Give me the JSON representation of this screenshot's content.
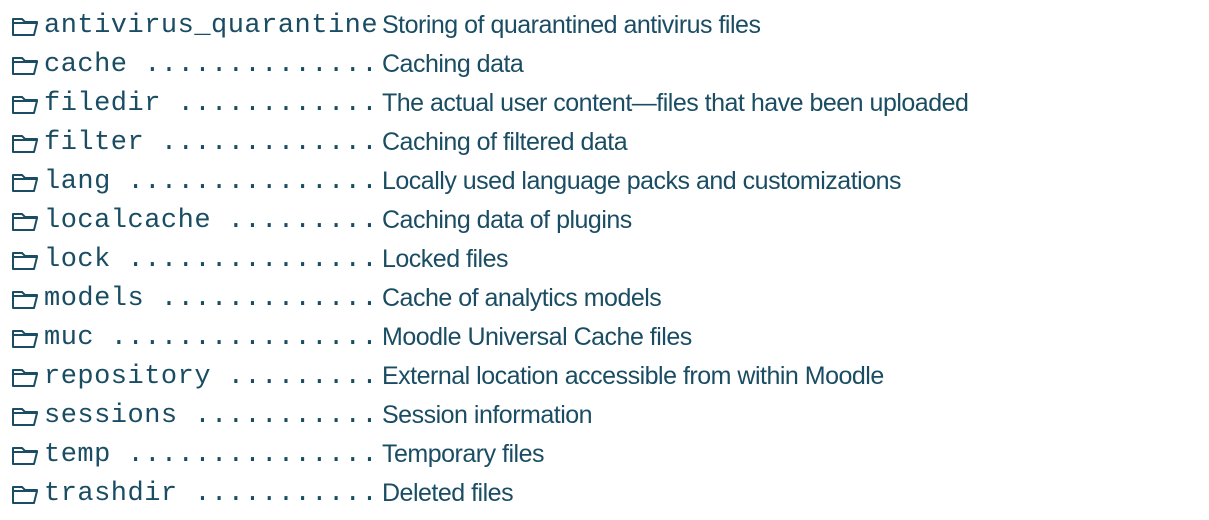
{
  "name_col_chars": 21,
  "dot_char": ".",
  "directories": [
    {
      "name": "antivirus_quarantine",
      "description": "Storing of quarantined antivirus files"
    },
    {
      "name": "cache",
      "description": "Caching data"
    },
    {
      "name": "filedir",
      "description": "The actual user content—files that have been uploaded"
    },
    {
      "name": "filter",
      "description": "Caching of filtered data"
    },
    {
      "name": "lang",
      "description": "Locally used language packs and customizations"
    },
    {
      "name": "localcache",
      "description": "Caching data of plugins"
    },
    {
      "name": "lock",
      "description": "Locked files"
    },
    {
      "name": "models",
      "description": "Cache of analytics models"
    },
    {
      "name": "muc",
      "description": "Moodle Universal Cache files"
    },
    {
      "name": "repository",
      "description": "External location accessible from within Moodle"
    },
    {
      "name": "sessions",
      "description": "Session information"
    },
    {
      "name": "temp",
      "description": "Temporary files"
    },
    {
      "name": "trashdir",
      "description": "Deleted files"
    }
  ]
}
